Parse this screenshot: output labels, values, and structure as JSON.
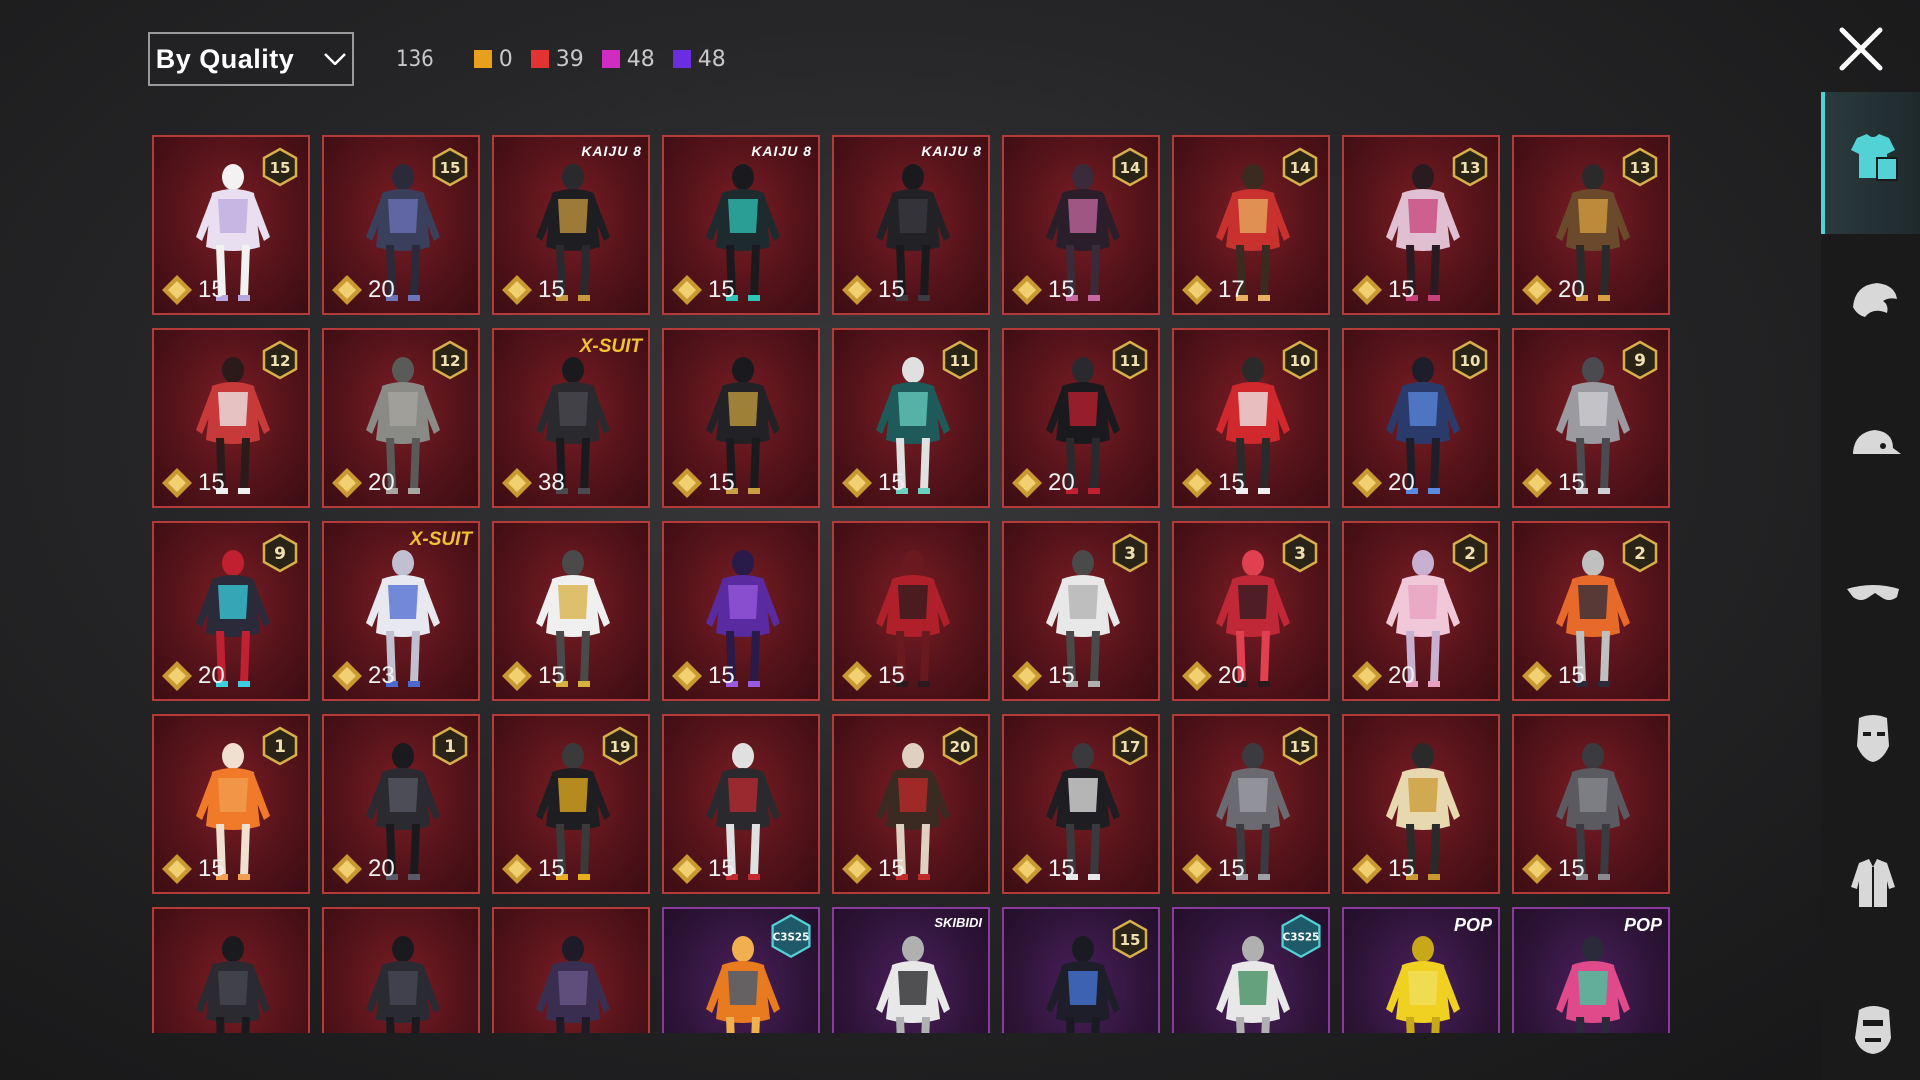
{
  "sort": {
    "label": "By Quality"
  },
  "total_count": "136",
  "quality_counts": [
    {
      "color": "#e8a01c",
      "count": "0"
    },
    {
      "color": "#e23232",
      "count": "39"
    },
    {
      "color": "#d12bc3",
      "count": "48"
    },
    {
      "color": "#6a2ee0",
      "count": "48"
    }
  ],
  "items": [
    {
      "badge": "15",
      "tag": "",
      "price": "15",
      "quality": "mythic",
      "figure": "white-lilac-dress"
    },
    {
      "badge": "15",
      "tag": "",
      "price": "20",
      "quality": "mythic",
      "figure": "dark-blue-armor"
    },
    {
      "badge": "",
      "tag": "KAIJU 8",
      "price": "15",
      "quality": "mythic",
      "figure": "black-bodysuit"
    },
    {
      "badge": "",
      "tag": "KAIJU 8",
      "price": "15",
      "quality": "mythic",
      "figure": "teal-kaiju-suit"
    },
    {
      "badge": "",
      "tag": "KAIJU 8",
      "price": "15",
      "quality": "mythic",
      "figure": "black-combat-suit"
    },
    {
      "badge": "14",
      "tag": "",
      "price": "15",
      "quality": "mythic",
      "figure": "pink-black-coat"
    },
    {
      "badge": "14",
      "tag": "",
      "price": "17",
      "quality": "mythic",
      "figure": "red-hood-outfit"
    },
    {
      "badge": "13",
      "tag": "",
      "price": "15",
      "quality": "mythic",
      "figure": "pink-skirt-outfit"
    },
    {
      "badge": "13",
      "tag": "",
      "price": "20",
      "quality": "mythic",
      "figure": "gold-jacket"
    },
    {
      "badge": "12",
      "tag": "",
      "price": "15",
      "quality": "mythic",
      "figure": "red-white-dress"
    },
    {
      "badge": "12",
      "tag": "",
      "price": "20",
      "quality": "mythic",
      "figure": "gray-bunny-suit"
    },
    {
      "badge": "",
      "tag": "X-SUIT",
      "price": "38",
      "quality": "mythic",
      "figure": "twin-dark-suits"
    },
    {
      "badge": "",
      "tag": "",
      "price": "15",
      "quality": "mythic",
      "figure": "dark-gold-cloak"
    },
    {
      "badge": "11",
      "tag": "",
      "price": "15",
      "quality": "mythic",
      "figure": "teal-robe"
    },
    {
      "badge": "11",
      "tag": "",
      "price": "20",
      "quality": "mythic",
      "figure": "red-black-suit"
    },
    {
      "badge": "10",
      "tag": "",
      "price": "15",
      "quality": "mythic",
      "figure": "red-dress"
    },
    {
      "badge": "10",
      "tag": "",
      "price": "20",
      "quality": "mythic",
      "figure": "blue-knight-cape"
    },
    {
      "badge": "9",
      "tag": "",
      "price": "15",
      "quality": "mythic",
      "figure": "silver-armor"
    },
    {
      "badge": "9",
      "tag": "",
      "price": "20",
      "quality": "mythic",
      "figure": "teal-hair-outfit"
    },
    {
      "badge": "",
      "tag": "X-SUIT",
      "price": "23",
      "quality": "mythic",
      "figure": "white-blue-suit"
    },
    {
      "badge": "",
      "tag": "",
      "price": "15",
      "quality": "mythic",
      "figure": "white-gold-armor"
    },
    {
      "badge": "",
      "tag": "",
      "price": "15",
      "quality": "mythic",
      "figure": "purple-wings"
    },
    {
      "badge": "",
      "tag": "",
      "price": "15",
      "quality": "mythic",
      "figure": "red-hooded-figure"
    },
    {
      "badge": "3",
      "tag": "",
      "price": "15",
      "quality": "mythic",
      "figure": "white-long-coat"
    },
    {
      "badge": "3",
      "tag": "",
      "price": "20",
      "quality": "mythic",
      "figure": "red-hood-suit"
    },
    {
      "badge": "2",
      "tag": "",
      "price": "20",
      "quality": "mythic",
      "figure": "pink-gown"
    },
    {
      "badge": "2",
      "tag": "",
      "price": "15",
      "quality": "mythic",
      "figure": "orange-duo"
    },
    {
      "badge": "1",
      "tag": "",
      "price": "15",
      "quality": "mythic",
      "figure": "orange-dress"
    },
    {
      "badge": "1",
      "tag": "",
      "price": "20",
      "quality": "mythic",
      "figure": "dark-hood-armor"
    },
    {
      "badge": "19",
      "tag": "",
      "price": "15",
      "quality": "mythic",
      "figure": "yellow-cape"
    },
    {
      "badge": "",
      "tag": "",
      "price": "15",
      "quality": "mythic",
      "figure": "red-mech-armor"
    },
    {
      "badge": "20",
      "tag": "",
      "price": "15",
      "quality": "mythic",
      "figure": "red-hooded-coat"
    },
    {
      "badge": "17",
      "tag": "",
      "price": "15",
      "quality": "mythic",
      "figure": "black-white-suit"
    },
    {
      "badge": "15",
      "tag": "",
      "price": "15",
      "quality": "mythic",
      "figure": "gray-armor"
    },
    {
      "badge": "",
      "tag": "",
      "price": "15",
      "quality": "mythic",
      "figure": "gold-white-suit"
    },
    {
      "badge": "",
      "tag": "",
      "price": "15",
      "quality": "mythic",
      "figure": "gray-tactical"
    },
    {
      "badge": "",
      "tag": "",
      "price": "",
      "quality": "mythic",
      "figure": "dark-ninja"
    },
    {
      "badge": "",
      "tag": "",
      "price": "",
      "quality": "mythic",
      "figure": "dark-hood"
    },
    {
      "badge": "",
      "tag": "",
      "price": "",
      "quality": "mythic",
      "figure": "purple-hood"
    },
    {
      "badge": "C3S25",
      "tag": "",
      "price": "",
      "quality": "legendary",
      "figure": "orange-jacket"
    },
    {
      "badge": "",
      "tag": "SKIBIDI",
      "price": "",
      "quality": "legendary",
      "figure": "white-shirt"
    },
    {
      "badge": "15",
      "tag": "",
      "price": "",
      "quality": "legendary",
      "figure": "dark-neon-suit"
    },
    {
      "badge": "C3S25",
      "tag": "",
      "price": "",
      "quality": "legendary",
      "figure": "white-green-armor"
    },
    {
      "badge": "",
      "tag": "POP",
      "price": "",
      "quality": "legendary",
      "figure": "yellow-shirt"
    },
    {
      "badge": "",
      "tag": "POP",
      "price": "",
      "quality": "legendary",
      "figure": "pink-green-outfit"
    }
  ],
  "sidebar": [
    {
      "icon": "outfit-icon",
      "active": true
    },
    {
      "icon": "hair-icon",
      "active": false
    },
    {
      "icon": "cap-icon",
      "active": false
    },
    {
      "icon": "glasses-icon",
      "active": false
    },
    {
      "icon": "mask-icon",
      "active": false
    },
    {
      "icon": "jacket-icon",
      "active": false
    },
    {
      "icon": "face-icon",
      "active": false
    }
  ],
  "colors": {
    "mythic_border": "#b53a3a",
    "legendary_border": "#8a3a9e",
    "accent": "#53d2d5"
  }
}
